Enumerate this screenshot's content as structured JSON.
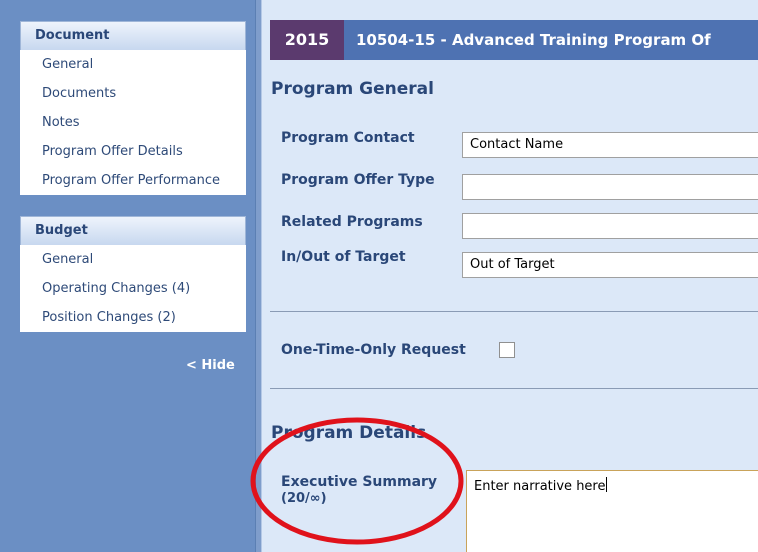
{
  "sidebar": {
    "document_header": "Document",
    "document_items": [
      "General",
      "Documents",
      "Notes",
      "Program Offer Details",
      "Program Offer Performance"
    ],
    "budget_header": "Budget",
    "budget_items": [
      "General",
      "Operating Changes (4)",
      "Position Changes (2)"
    ],
    "hide_label": "< Hide"
  },
  "header": {
    "year": "2015",
    "title": "10504-15 - Advanced Training Program Of"
  },
  "program_general": {
    "title": "Program General",
    "contact_label": "Program Contact",
    "contact_value": "Contact Name",
    "offer_type_label": "Program Offer Type",
    "offer_type_value": "",
    "related_label": "Related Programs",
    "related_value": "",
    "target_label": "In/Out of Target",
    "target_value": "Out of Target",
    "one_time_label": "One-Time-Only Request",
    "one_time_checked": false
  },
  "program_details": {
    "title": "Program Details",
    "summary_label": "Executive Summary",
    "summary_counter": "(20/∞)",
    "summary_value": "Enter narrative here"
  },
  "colors": {
    "sidebar_bg": "#6b8fc4",
    "main_bg": "#dce8f8",
    "title_bar": "#4e72b2",
    "year_badge": "#5b3a6e",
    "annotation": "#e0121b"
  }
}
